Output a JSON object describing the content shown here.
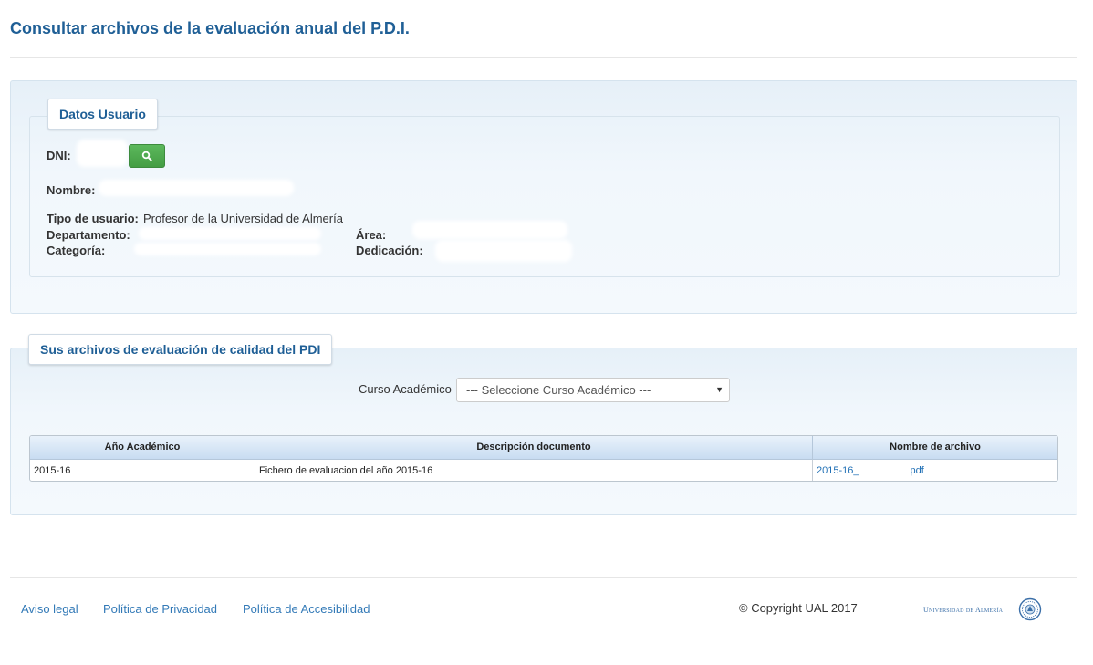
{
  "page": {
    "title": "Consultar archivos de la evaluación anual del P.D.I."
  },
  "user_section": {
    "legend": "Datos Usuario",
    "dni_label": "DNI:",
    "nombre_label": "Nombre:",
    "tipo_label": "Tipo de usuario:",
    "tipo_value": "Profesor de la Universidad de Almería",
    "departamento_label": "Departamento:",
    "categoria_label": "Categoría:",
    "area_label": "Área:",
    "dedicacion_label": "Dedicación:",
    "search_icon": "search-icon"
  },
  "files_section": {
    "legend": "Sus archivos de evaluación de calidad del PDI",
    "curso_label": "Curso Académico",
    "curso_select_value": "--- Seleccione Curso Académico ---",
    "table": {
      "headers": [
        "Año Académico",
        "Descripción documento",
        "Nombre de archivo"
      ],
      "rows": [
        {
          "anio": "2015-16",
          "descripcion": "Fichero de evaluacion del año 2015-16",
          "archivo_prefix": "2015-16_",
          "archivo_suffix": "pdf"
        }
      ]
    }
  },
  "footer": {
    "links": [
      "Aviso legal",
      "Política de Privacidad",
      "Política de Accesibilidad"
    ],
    "copyright": "© Copyright UAL 2017",
    "logo_text": "Universidad de Almería"
  },
  "colors": {
    "title_blue": "#1f5f96",
    "link_blue": "#337ab7",
    "search_green": "#5cb85c"
  }
}
